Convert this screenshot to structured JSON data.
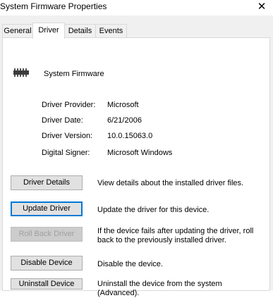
{
  "window": {
    "title": "System Firmware Properties",
    "close_glyph": "✕"
  },
  "tabs": [
    {
      "label": "General",
      "active": false
    },
    {
      "label": "Driver",
      "active": true
    },
    {
      "label": "Details",
      "active": false
    },
    {
      "label": "Events",
      "active": false
    }
  ],
  "device": {
    "name": "System Firmware",
    "icon": "chip-icon"
  },
  "properties": [
    {
      "label": "Driver Provider:",
      "value": "Microsoft"
    },
    {
      "label": "Driver Date:",
      "value": "6/21/2006"
    },
    {
      "label": "Driver Version:",
      "value": "10.0.15063.0"
    },
    {
      "label": "Digital Signer:",
      "value": "Microsoft Windows"
    }
  ],
  "actions": [
    {
      "label": "Driver Details",
      "description": "View details about the installed driver files.",
      "enabled": true
    },
    {
      "label": "Update Driver",
      "description": "Update the driver for this device.",
      "enabled": true,
      "focused": true
    },
    {
      "label": "Roll Back Driver",
      "description": "If the device fails after updating the driver, roll back to the previously installed driver.",
      "enabled": false
    },
    {
      "label": "Disable Device",
      "description": "Disable the device.",
      "enabled": true
    },
    {
      "label": "Uninstall Device",
      "description": "Uninstall the device from the system (Advanced).",
      "enabled": true
    }
  ],
  "colors": {
    "focus": "#0078d7",
    "button_bg": "#e1e1e1",
    "disabled_text": "#a0a0a0"
  }
}
